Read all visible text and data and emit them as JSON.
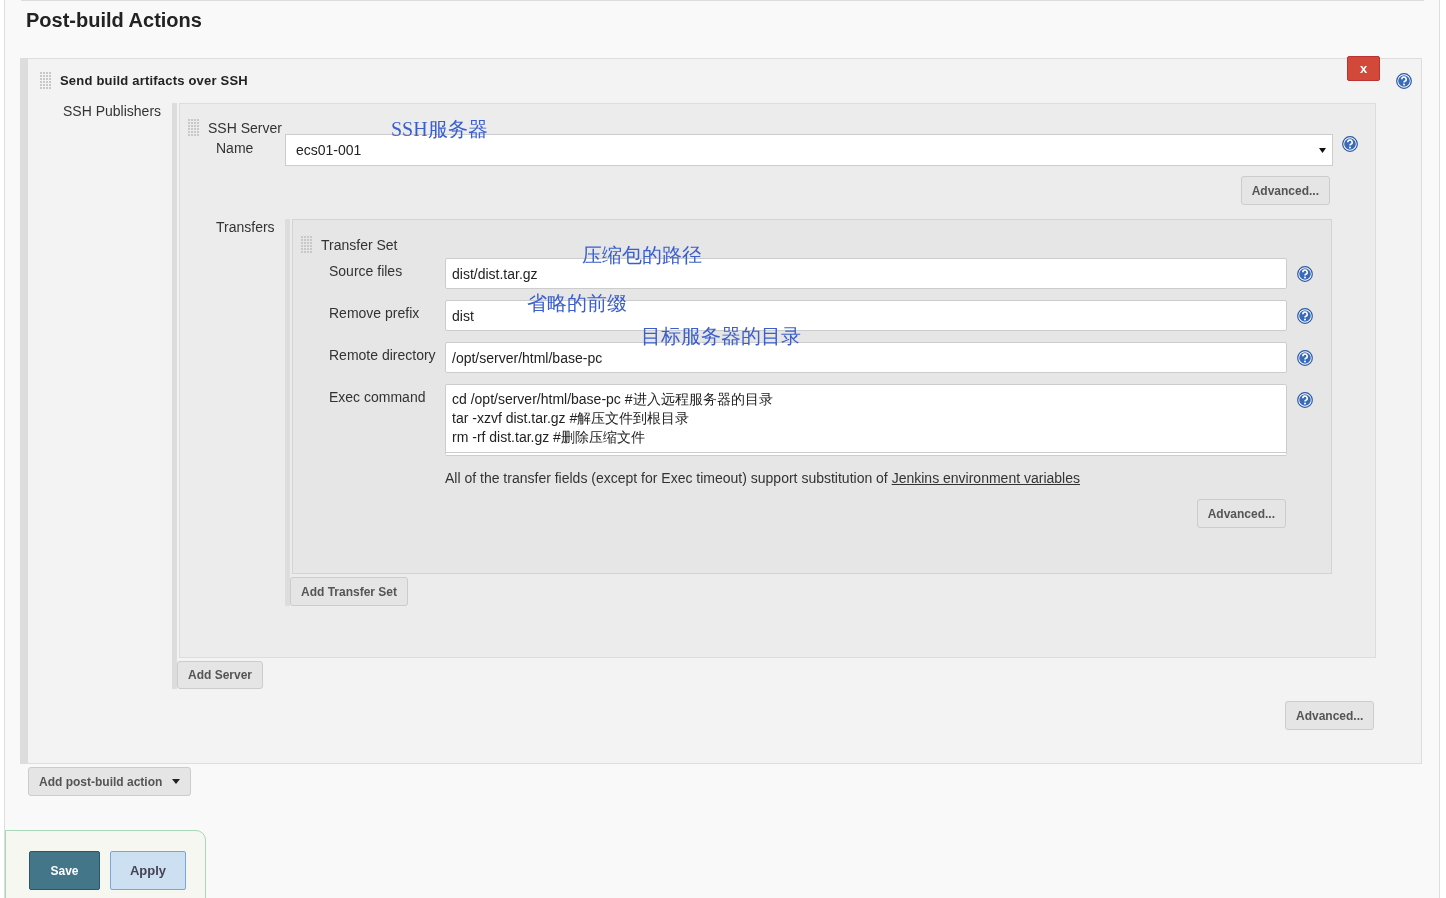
{
  "section_title": "Post-build Actions",
  "action": {
    "title": "Send build artifacts over SSH",
    "delete_label": "x",
    "publishers_label": "SSH Publishers",
    "server": {
      "title": "SSH Server",
      "annotation": "SSH服务器",
      "name_label": "Name",
      "name_value": "ecs01-001",
      "advanced": "Advanced..."
    },
    "transfers_label": "Transfers",
    "transfer_set": {
      "title": "Transfer Set",
      "fields": [
        {
          "kind": "input",
          "label": "Source files",
          "value": "dist/dist.tar.gz",
          "annotation": "压缩包的路径"
        },
        {
          "kind": "input",
          "label": "Remove prefix",
          "value": "dist",
          "annotation": "省略的前缀"
        },
        {
          "kind": "input",
          "label": "Remote directory",
          "value": "/opt/server/html/base-pc",
          "annotation": "目标服务器的目录"
        },
        {
          "kind": "textarea",
          "label": "Exec command",
          "value": "cd /opt/server/html/base-pc #进入远程服务器的目录\ntar -xzvf dist.tar.gz #解压文件到根目录\nrm -rf dist.tar.gz #删除压缩文件"
        }
      ],
      "note": "All of the transfer fields (except for Exec timeout) support substitution of",
      "note_link": "Jenkins environment variables",
      "advanced": "Advanced..."
    },
    "add_transfer_set": "Add Transfer Set",
    "add_server": "Add Server",
    "advanced": "Advanced..."
  },
  "add_action": "Add post-build action",
  "buttons": [
    {
      "kind": "primary",
      "label": "Save"
    },
    {
      "kind": "secondary",
      "label": "Apply"
    }
  ]
}
